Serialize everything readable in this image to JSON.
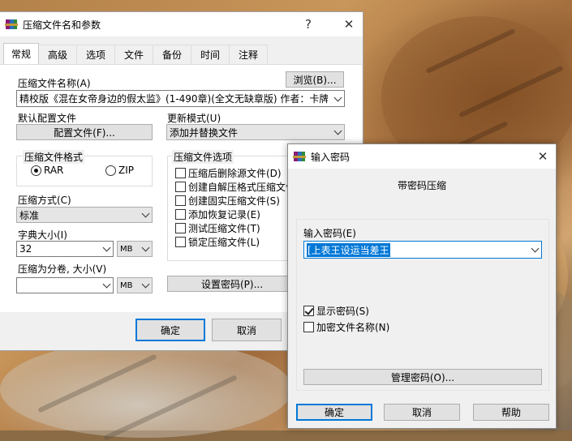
{
  "main_dialog": {
    "title": "压缩文件名和参数",
    "help_glyph": "?",
    "close_glyph": "✕",
    "tabs": [
      {
        "label": "常规",
        "active": true
      },
      {
        "label": "高级"
      },
      {
        "label": "选项"
      },
      {
        "label": "文件"
      },
      {
        "label": "备份"
      },
      {
        "label": "时间"
      },
      {
        "label": "注释"
      }
    ],
    "archive_name_label": "压缩文件名称(A)",
    "browse_button": "浏览(B)...",
    "archive_name_value": "精校版《混在女帝身边的假太监》(1-490章)(全文无缺章版) 作者：卡牌",
    "default_profile_label": "默认配置文件",
    "profile_button": "配置文件(F)...",
    "update_mode_label": "更新模式(U)",
    "update_mode_value": "添加并替换文件",
    "format_group_title": "压缩文件格式",
    "format_rar": "RAR",
    "format_zip": "ZIP",
    "method_label": "压缩方式(C)",
    "method_value": "标准",
    "dict_label": "字典大小(I)",
    "dict_value": "32",
    "dict_unit": "MB",
    "volume_label": "压缩为分卷, 大小(V)",
    "volume_value": "",
    "volume_unit": "MB",
    "options_group_title": "压缩文件选项",
    "options": [
      {
        "label": "压缩后删除源文件(D)",
        "checked": false
      },
      {
        "label": "创建自解压格式压缩文件",
        "checked": false
      },
      {
        "label": "创建固实压缩文件(S)",
        "checked": false
      },
      {
        "label": "添加恢复记录(E)",
        "checked": false
      },
      {
        "label": "测试压缩文件(T)",
        "checked": false
      },
      {
        "label": "锁定压缩文件(L)",
        "checked": false
      }
    ],
    "set_password_button": "设置密码(P)...",
    "ok_button": "确定",
    "cancel_button": "取消"
  },
  "password_dialog": {
    "title": "输入密码",
    "close_glyph": "✕",
    "heading": "带密码压缩",
    "password_label": "输入密码(E)",
    "password_value": "[上表王设运当差王",
    "show_password_label": "显示密码(S)",
    "show_password_checked": true,
    "encrypt_names_label": "加密文件名称(N)",
    "encrypt_names_checked": false,
    "manage_button": "管理密码(O)...",
    "ok_button": "确定",
    "cancel_button": "取消",
    "help_button": "帮助"
  }
}
